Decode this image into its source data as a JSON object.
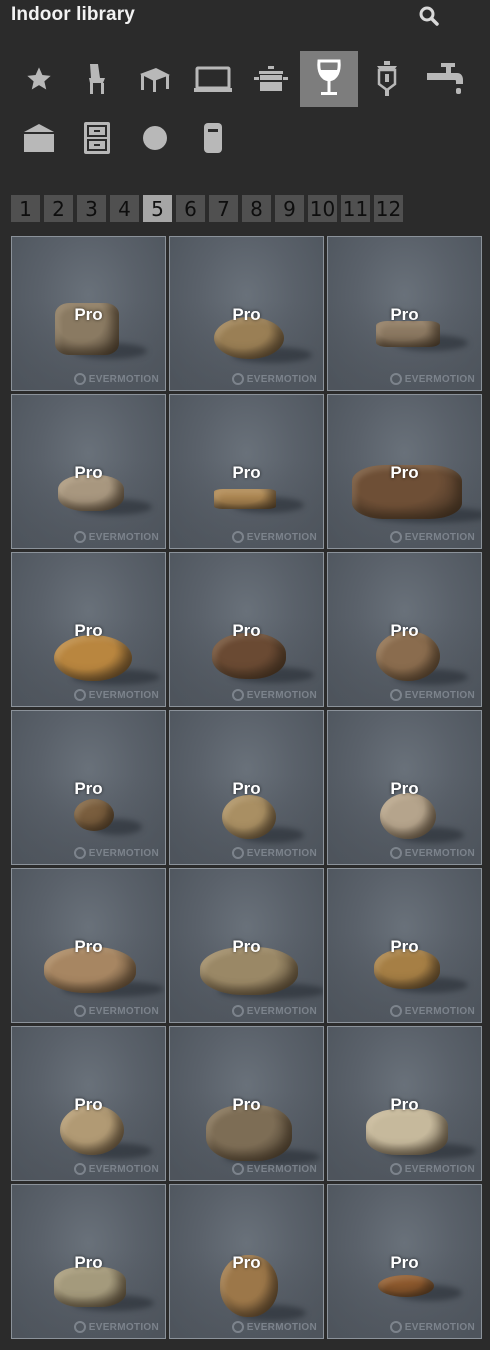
{
  "header": {
    "title": "Indoor library",
    "search_icon": "search-icon"
  },
  "categories": [
    {
      "name": "favorites",
      "icon": "star-icon",
      "active": false
    },
    {
      "name": "chairs",
      "icon": "chair-icon",
      "active": false
    },
    {
      "name": "tables",
      "icon": "table-icon",
      "active": false
    },
    {
      "name": "electronics",
      "icon": "laptop-icon",
      "active": false
    },
    {
      "name": "kitchen",
      "icon": "pot-icon",
      "active": false
    },
    {
      "name": "tableware",
      "icon": "wine-glass-icon",
      "active": true
    },
    {
      "name": "lighting",
      "icon": "lantern-icon",
      "active": false
    },
    {
      "name": "bathroom",
      "icon": "faucet-icon",
      "active": false
    },
    {
      "name": "storage",
      "icon": "box-icon",
      "active": false
    },
    {
      "name": "cabinets",
      "icon": "cabinet-icon",
      "active": false
    },
    {
      "name": "misc",
      "icon": "circle-icon",
      "active": false
    },
    {
      "name": "other",
      "icon": "cylinder-icon",
      "active": false
    }
  ],
  "pagination": {
    "pages": [
      "1",
      "2",
      "3",
      "4",
      "5",
      "6",
      "7",
      "8",
      "9",
      "10",
      "11",
      "12"
    ],
    "current": "5"
  },
  "items": [
    {
      "badge": "Pro",
      "watermark": "EVERMOTION",
      "shape": "loaf-block",
      "color": "#8a7a62"
    },
    {
      "badge": "Pro",
      "watermark": "EVERMOTION",
      "shape": "oval",
      "color": "#9a7f55"
    },
    {
      "badge": "Pro",
      "watermark": "EVERMOTION",
      "shape": "slice-flat",
      "color": "#8d7a63"
    },
    {
      "badge": "Pro",
      "watermark": "EVERMOTION",
      "shape": "bun-light",
      "color": "#a8977f"
    },
    {
      "badge": "Pro",
      "watermark": "EVERMOTION",
      "shape": "toast",
      "color": "#b08a55"
    },
    {
      "badge": "Pro",
      "watermark": "EVERMOTION",
      "shape": "sliced-loaf",
      "color": "#6e4f36"
    },
    {
      "badge": "Pro",
      "watermark": "EVERMOTION",
      "shape": "oval-wide",
      "color": "#b9863f"
    },
    {
      "badge": "Pro",
      "watermark": "EVERMOTION",
      "shape": "oval-dark",
      "color": "#6a4a33"
    },
    {
      "badge": "Pro",
      "watermark": "EVERMOTION",
      "shape": "round",
      "color": "#8a6c4e"
    },
    {
      "badge": "Pro",
      "watermark": "EVERMOTION",
      "shape": "small",
      "color": "#7a5e3e"
    },
    {
      "badge": "Pro",
      "watermark": "EVERMOTION",
      "shape": "round-small",
      "color": "#a98f63"
    },
    {
      "badge": "Pro",
      "watermark": "EVERMOTION",
      "shape": "round-light",
      "color": "#b5a48c"
    },
    {
      "badge": "Pro",
      "watermark": "EVERMOTION",
      "shape": "braid",
      "color": "#a78662"
    },
    {
      "badge": "Pro",
      "watermark": "EVERMOTION",
      "shape": "broken",
      "color": "#9a8866"
    },
    {
      "badge": "Pro",
      "watermark": "EVERMOTION",
      "shape": "braid-small",
      "color": "#a67f45"
    },
    {
      "badge": "Pro",
      "watermark": "EVERMOTION",
      "shape": "round",
      "color": "#b19a74"
    },
    {
      "badge": "Pro",
      "watermark": "EVERMOTION",
      "shape": "broken-dark",
      "color": "#7d6d55"
    },
    {
      "badge": "Pro",
      "watermark": "EVERMOTION",
      "shape": "flat-light",
      "color": "#c6b99c"
    },
    {
      "badge": "Pro",
      "watermark": "EVERMOTION",
      "shape": "flat-herb",
      "color": "#a49a7c"
    },
    {
      "badge": "Pro",
      "watermark": "EVERMOTION",
      "shape": "round-tall",
      "color": "#9c7749"
    },
    {
      "badge": "Pro",
      "watermark": "EVERMOTION",
      "shape": "baguette-small",
      "color": "#8f5a2e"
    }
  ]
}
